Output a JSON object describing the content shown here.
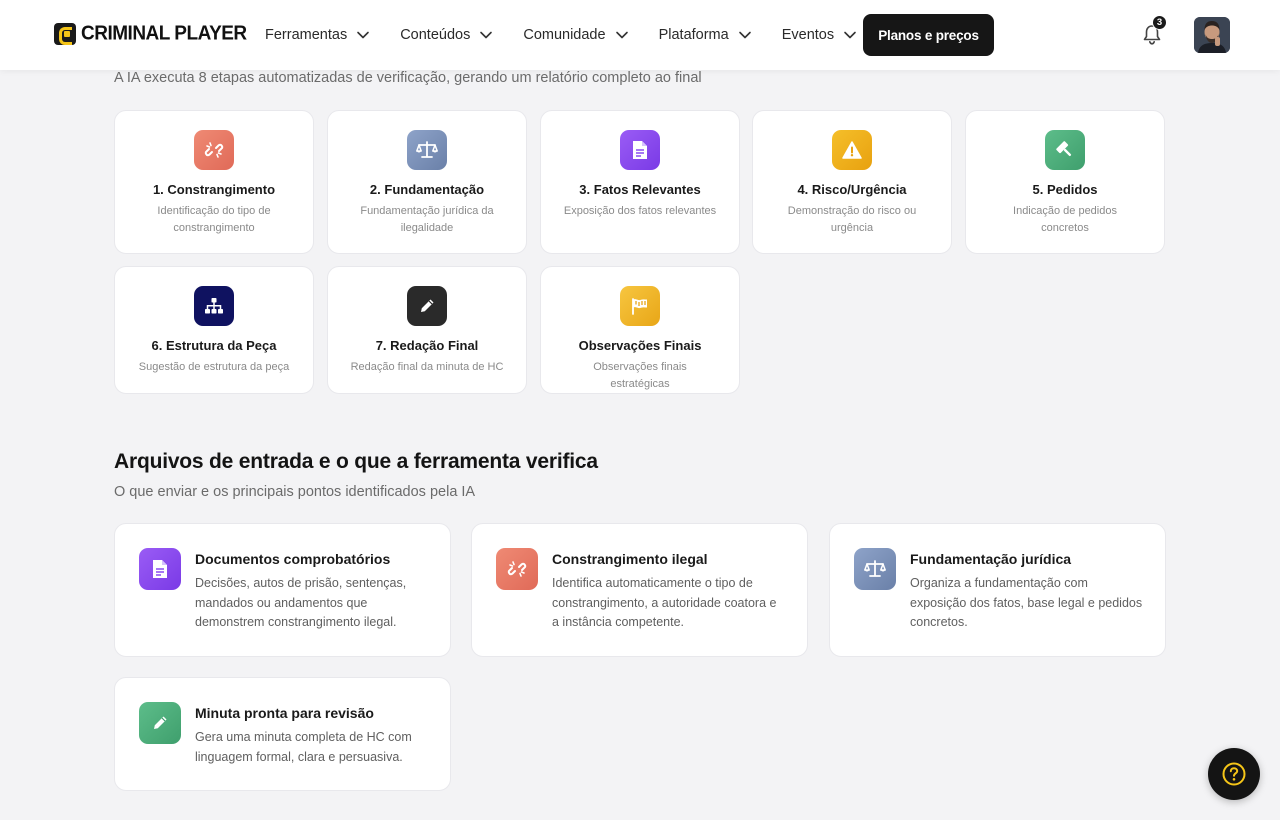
{
  "header": {
    "logo_text": "CRIMINAL PLAYER",
    "nav": [
      {
        "label": "Ferramentas"
      },
      {
        "label": "Conteúdos"
      },
      {
        "label": "Comunidade"
      },
      {
        "label": "Plataforma"
      },
      {
        "label": "Eventos"
      }
    ],
    "cta_label": "Planos e preços",
    "notification_count": "3"
  },
  "steps_section": {
    "subtitle": "A IA executa 8 etapas automatizadas de verificação, gerando um relatório completo ao final",
    "steps": [
      {
        "title": "1. Constrangimento",
        "desc": "Identificação do tipo de constrangimento",
        "icon": "broken-link-icon",
        "color": "#e8745f"
      },
      {
        "title": "2. Fundamentação",
        "desc": "Fundamentação jurídica da ilegalidade",
        "icon": "scales-icon",
        "color": "#7b90b8"
      },
      {
        "title": "3. Fatos Relevantes",
        "desc": "Exposição dos fatos relevantes",
        "icon": "document-icon",
        "color": "#8845ee"
      },
      {
        "title": "4. Risco/Urgência",
        "desc": "Demonstração do risco ou urgência",
        "icon": "warning-icon",
        "color": "#eeae1a"
      },
      {
        "title": "5. Pedidos",
        "desc": "Indicação de pedidos concretos",
        "icon": "gavel-icon",
        "color": "#4cad7b"
      },
      {
        "title": "6. Estrutura da Peça",
        "desc": "Sugestão de estrutura da peça",
        "icon": "sitemap-icon",
        "color": "#0f1260"
      },
      {
        "title": "7. Redação Final",
        "desc": "Redação final da minuta de HC",
        "icon": "pencil-icon",
        "color": "#2a2a2a"
      },
      {
        "title": "Observações Finais",
        "desc": "Observações finais estratégicas",
        "icon": "flag-icon",
        "color": "#efb52b"
      }
    ]
  },
  "files_section": {
    "title": "Arquivos de entrada e o que a ferramenta verifica",
    "subtitle": "O que enviar e os principais pontos identificados pela IA",
    "cards": [
      {
        "title": "Documentos comprobatórios",
        "desc": "Decisões, autos de prisão, sentenças, mandados ou andamentos que demonstrem constrangimento ilegal.",
        "icon": "document-icon"
      },
      {
        "title": "Constrangimento ilegal",
        "desc": "Identifica automaticamente o tipo de constrangimento, a autoridade coatora e a instância competente.",
        "icon": "broken-link-icon"
      },
      {
        "title": "Fundamentação jurídica",
        "desc": "Organiza a fundamentação com exposição dos fatos, base legal e pedidos concretos.",
        "icon": "scales-icon"
      },
      {
        "title": "Minuta pronta para revisão",
        "desc": "Gera uma minuta completa de HC com linguagem formal, clara e persuasiva.",
        "icon": "pencil-icon"
      }
    ]
  },
  "help": {
    "icon": "help-icon",
    "accent": "#f5c518"
  }
}
